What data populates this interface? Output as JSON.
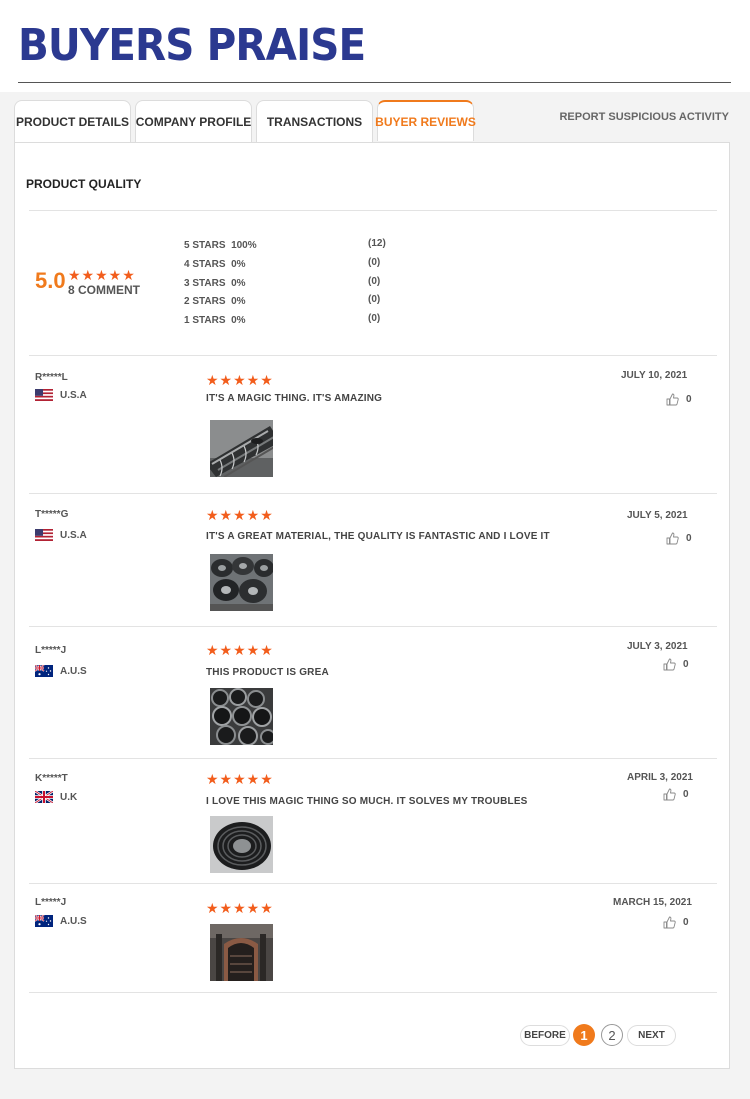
{
  "header": {
    "title": "BUYERS PRAISE"
  },
  "tabs": [
    {
      "label": "PRODUCT DETAILS",
      "active": false
    },
    {
      "label": "COMPANY PROFILE",
      "active": false
    },
    {
      "label": "TRANSACTIONS",
      "active": false
    },
    {
      "label": "BUYER REVIEWS",
      "active": true
    }
  ],
  "report_link": "REPORT SUSPICIOUS ACTIVITY",
  "summary": {
    "section_label": "PRODUCT QUALITY",
    "average": "5.0",
    "rating": 5,
    "comment_count": "8 COMMENT",
    "distribution": [
      {
        "label": "5 STARS",
        "percent": "100%",
        "count": "(12)"
      },
      {
        "label": "4 STARS",
        "percent": "0%",
        "count": "(0)"
      },
      {
        "label": "3 STARS",
        "percent": "0%",
        "count": "(0)"
      },
      {
        "label": "2 STARS",
        "percent": "0%",
        "count": "(0)"
      },
      {
        "label": "1 STARS",
        "percent": "0%",
        "count": "(0)"
      }
    ]
  },
  "stars_glyph": "★★★★★",
  "reviews": [
    {
      "name": "R*****L",
      "country": "U.S.A",
      "flag": "us-flag",
      "rating": 5,
      "date": "JULY 10, 2021",
      "text": "IT'S A MAGIC THING. IT'S AMAZING",
      "likes": "0",
      "photo": "spiral-duct-photo"
    },
    {
      "name": "T*****G",
      "country": "U.S.A",
      "flag": "us-flag",
      "rating": 5,
      "date": "JULY 5, 2021",
      "text": "IT'S A GREAT MATERIAL, THE QUALITY IS FANTASTIC AND I LOVE IT",
      "likes": "0",
      "photo": "pipe-coils-photo"
    },
    {
      "name": "L*****J",
      "country": "A.U.S",
      "flag": "au-flag",
      "rating": 5,
      "date": "JULY 3, 2021",
      "text": "THIS PRODUCT IS GREA",
      "likes": "0",
      "photo": "pipe-stack-photo"
    },
    {
      "name": "K*****T",
      "country": "U.K",
      "flag": "uk-flag",
      "rating": 5,
      "date": "APRIL 3, 2021",
      "text": "I LOVE THIS MAGIC THING SO MUCH. IT SOLVES MY TROUBLES",
      "likes": "0",
      "photo": "hose-coil-photo"
    },
    {
      "name": "L*****J",
      "country": "A.U.S",
      "flag": "au-flag",
      "rating": 5,
      "date": "MARCH 15, 2021",
      "text": "",
      "likes": "0",
      "photo": "workshop-pipe-photo"
    }
  ],
  "pagination": {
    "before": "BEFORE",
    "pages": [
      "1",
      "2"
    ],
    "current": "1",
    "next": "NEXT"
  },
  "colors": {
    "accent": "#f07a1c",
    "star": "#f25d1c",
    "title": "#2b3990"
  }
}
